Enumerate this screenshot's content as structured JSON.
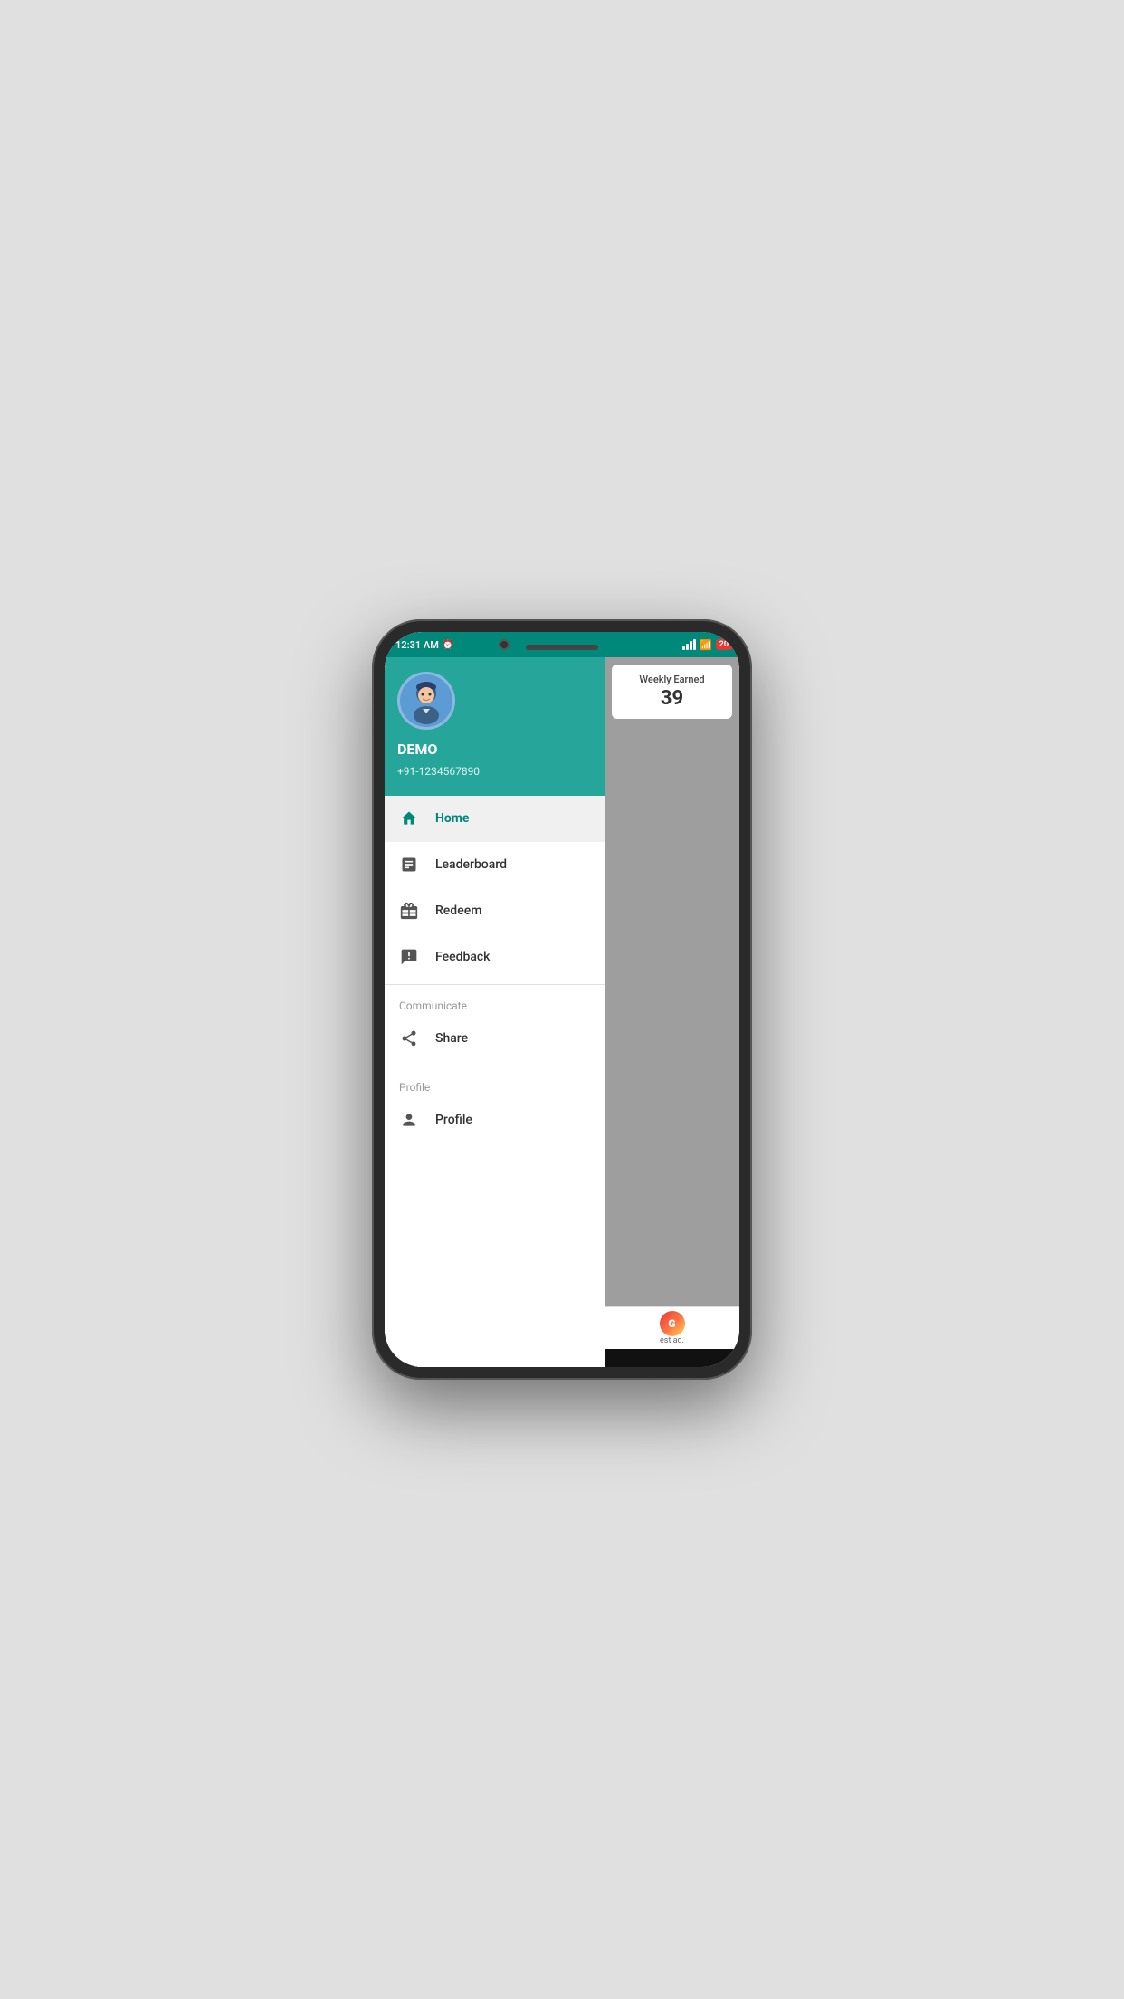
{
  "statusBar": {
    "time": "12:31 AM",
    "alarmIcon": "⏰",
    "batteryLevel": "20"
  },
  "profileHeader": {
    "userName": "DEMO",
    "userPhone": "+91-1234567890"
  },
  "menuItems": [
    {
      "id": "home",
      "label": "Home",
      "icon": "home",
      "active": true
    },
    {
      "id": "leaderboard",
      "label": "Leaderboard",
      "icon": "leaderboard",
      "active": false
    },
    {
      "id": "redeem",
      "label": "Redeem",
      "icon": "redeem",
      "active": false
    },
    {
      "id": "feedback",
      "label": "Feedback",
      "icon": "feedback",
      "active": false
    }
  ],
  "communicate": {
    "sectionLabel": "Communicate",
    "items": [
      {
        "id": "share",
        "label": "Share",
        "icon": "share"
      }
    ]
  },
  "profile": {
    "sectionLabel": "Profile",
    "items": [
      {
        "id": "profile",
        "label": "Profile",
        "icon": "profile"
      }
    ]
  },
  "rightPanel": {
    "weeklyEarned": {
      "title": "Weekly Earned",
      "value": "39"
    },
    "adText": "est ad."
  }
}
